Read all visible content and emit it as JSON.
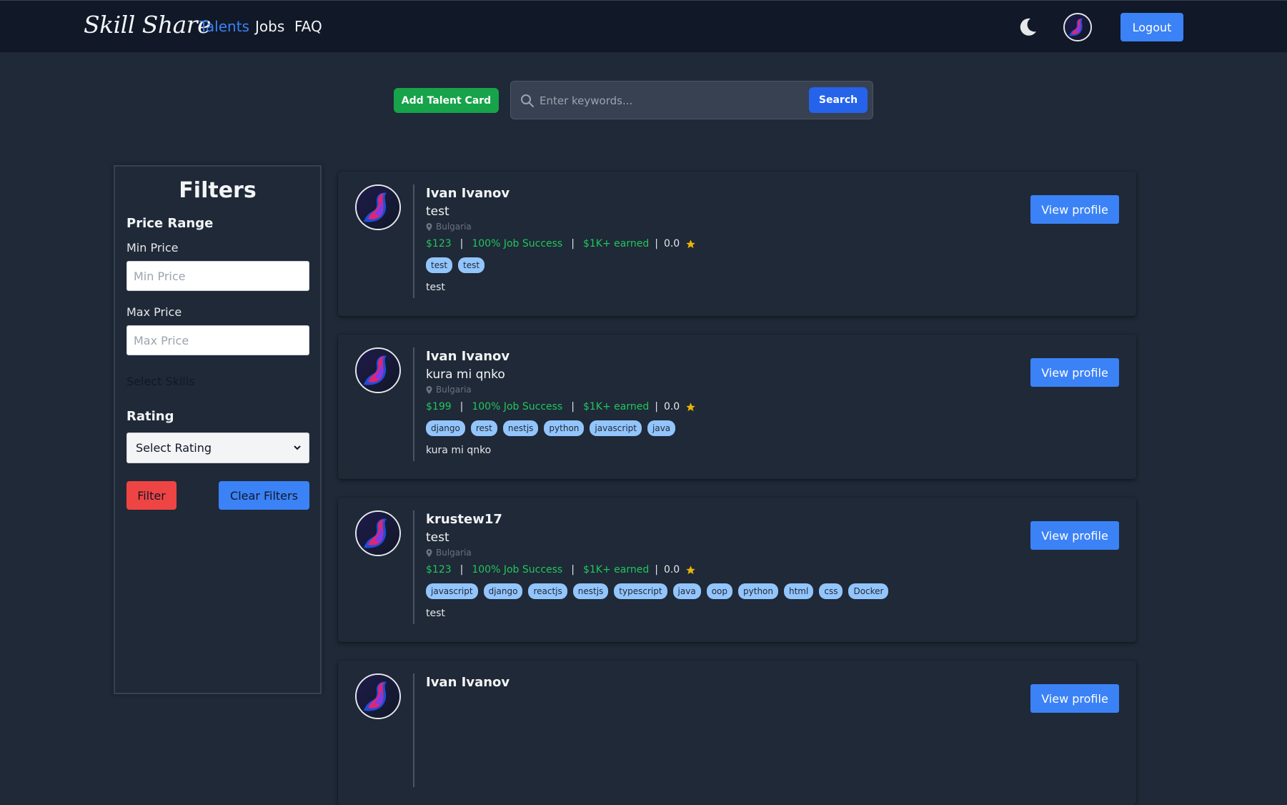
{
  "navbar": {
    "brand": "Skill Share",
    "links": [
      "Talents",
      "Jobs",
      "FAQ"
    ],
    "active_link": "Talents",
    "theme_icon": "moon-icon",
    "logout_label": "Logout"
  },
  "toolbar": {
    "add_talent_label": "Add Talent Card",
    "search_placeholder": "Enter keywords...",
    "search_label": "Search"
  },
  "filters": {
    "title": "Filters",
    "price_range_heading": "Price Range",
    "min_price_label": "Min Price",
    "min_price_placeholder": "Min Price",
    "max_price_label": "Max Price",
    "max_price_placeholder": "Max Price",
    "skills_label": "Select Skills",
    "rating_heading": "Rating",
    "rating_selected": "Select Rating",
    "filter_label": "Filter",
    "clear_label": "Clear Filters"
  },
  "cards": [
    {
      "name": "Ivan Ivanov",
      "title": "test",
      "location": "Bulgaria",
      "price": "$123",
      "job_success": "100% Job Success",
      "earned": "$1K+ earned",
      "rating": "0.0",
      "tags": [
        "test",
        "test"
      ],
      "description": "test",
      "view_label": "View profile"
    },
    {
      "name": "Ivan Ivanov",
      "title": "kura mi qnko",
      "location": "Bulgaria",
      "price": "$199",
      "job_success": "100% Job Success",
      "earned": "$1K+ earned",
      "rating": "0.0",
      "tags": [
        "django",
        "rest",
        "nestjs",
        "python",
        "javascript",
        "java"
      ],
      "description": "kura mi qnko",
      "view_label": "View profile"
    },
    {
      "name": "krustew17",
      "title": "test",
      "location": "Bulgaria",
      "price": "$123",
      "job_success": "100% Job Success",
      "earned": "$1K+ earned",
      "rating": "0.0",
      "tags": [
        "javascript",
        "django",
        "reactjs",
        "nestjs",
        "typescript",
        "java",
        "oop",
        "python",
        "html",
        "css",
        "Docker"
      ],
      "description": "test",
      "view_label": "View profile"
    },
    {
      "name": "Ivan Ivanov",
      "view_label": "View profile"
    }
  ],
  "colors": {
    "background": "#1f2937",
    "navbar": "#111827",
    "accent": "#3b82f6",
    "success": "#22c55e",
    "danger": "#ef4444",
    "tag": "#93c5fd",
    "star": "#eab308"
  }
}
